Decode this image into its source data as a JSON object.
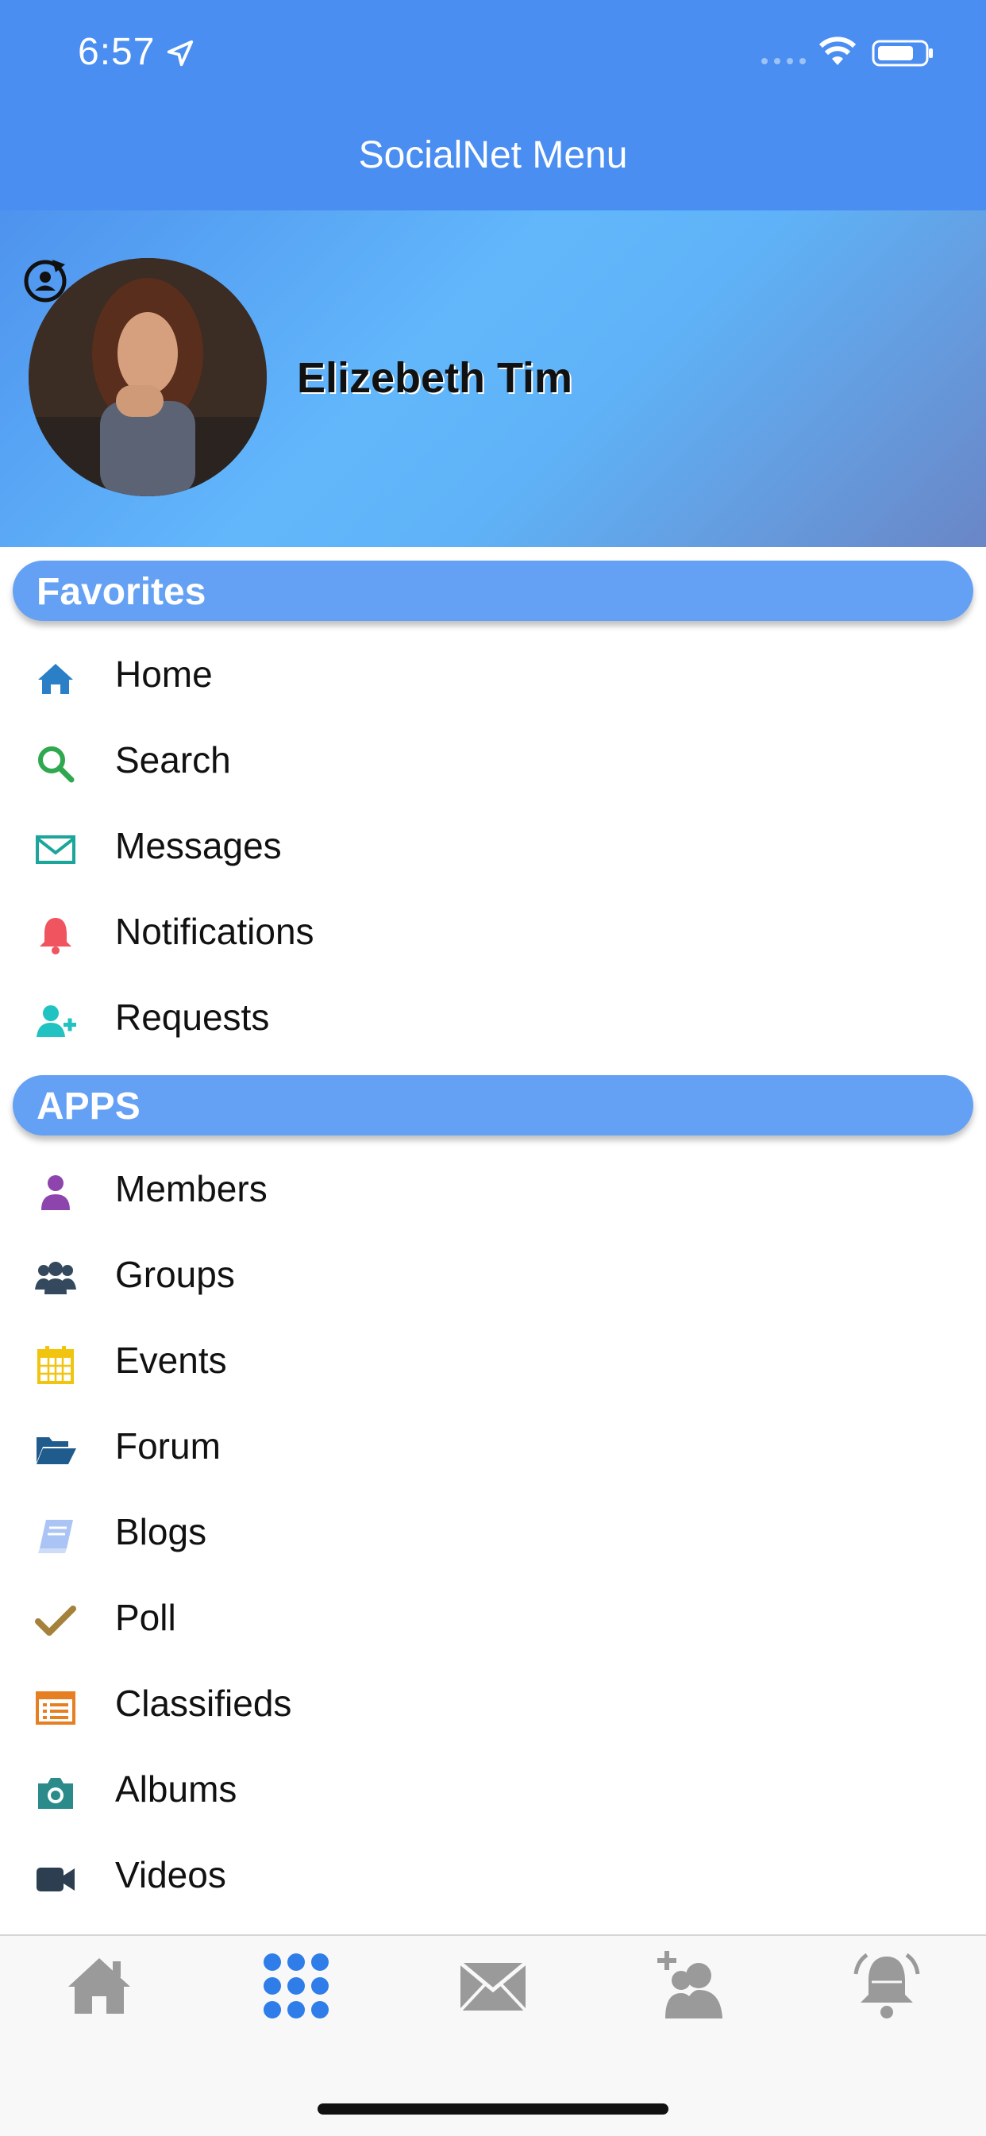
{
  "status_bar": {
    "time": "6:57"
  },
  "nav": {
    "title": "SocialNet Menu"
  },
  "profile": {
    "name": "Elizebeth Tim"
  },
  "favorites": {
    "title": "Favorites",
    "items": [
      {
        "label": "Home",
        "icon": "home-icon",
        "color": "#2a7fc6"
      },
      {
        "label": "Search",
        "icon": "search-icon",
        "color": "#2fa84f"
      },
      {
        "label": "Messages",
        "icon": "envelope-icon",
        "color": "#1aa69a"
      },
      {
        "label": "Notifications",
        "icon": "bell-icon",
        "color": "#f0545f"
      },
      {
        "label": "Requests",
        "icon": "user-plus-icon",
        "color": "#20c2c2"
      }
    ]
  },
  "apps": {
    "title": "APPS",
    "items": [
      {
        "label": "Members",
        "icon": "user-icon",
        "color": "#8e44ad"
      },
      {
        "label": "Groups",
        "icon": "users-icon",
        "color": "#34495e"
      },
      {
        "label": "Events",
        "icon": "calendar-icon",
        "color": "#f1c40f"
      },
      {
        "label": "Forum",
        "icon": "folder-open-icon",
        "color": "#1f5b8c"
      },
      {
        "label": "Blogs",
        "icon": "book-icon",
        "color": "#a9c4f5"
      },
      {
        "label": "Poll",
        "icon": "check-icon",
        "color": "#a5823c"
      },
      {
        "label": "Classifieds",
        "icon": "list-alt-icon",
        "color": "#e67e22"
      },
      {
        "label": "Albums",
        "icon": "camera-icon",
        "color": "#2b8a8a"
      },
      {
        "label": "Videos",
        "icon": "video-camera-icon",
        "color": "#2c3e50"
      }
    ]
  },
  "tabbar": {
    "tabs": [
      {
        "icon": "home-icon",
        "color": "#9a9a9a"
      },
      {
        "icon": "grid-dots-icon",
        "color": "#2f7de8"
      },
      {
        "icon": "envelope-icon",
        "color": "#9a9a9a"
      },
      {
        "icon": "user-plus-icon",
        "color": "#9a9a9a"
      },
      {
        "icon": "bell-icon",
        "color": "#9a9a9a"
      }
    ]
  }
}
